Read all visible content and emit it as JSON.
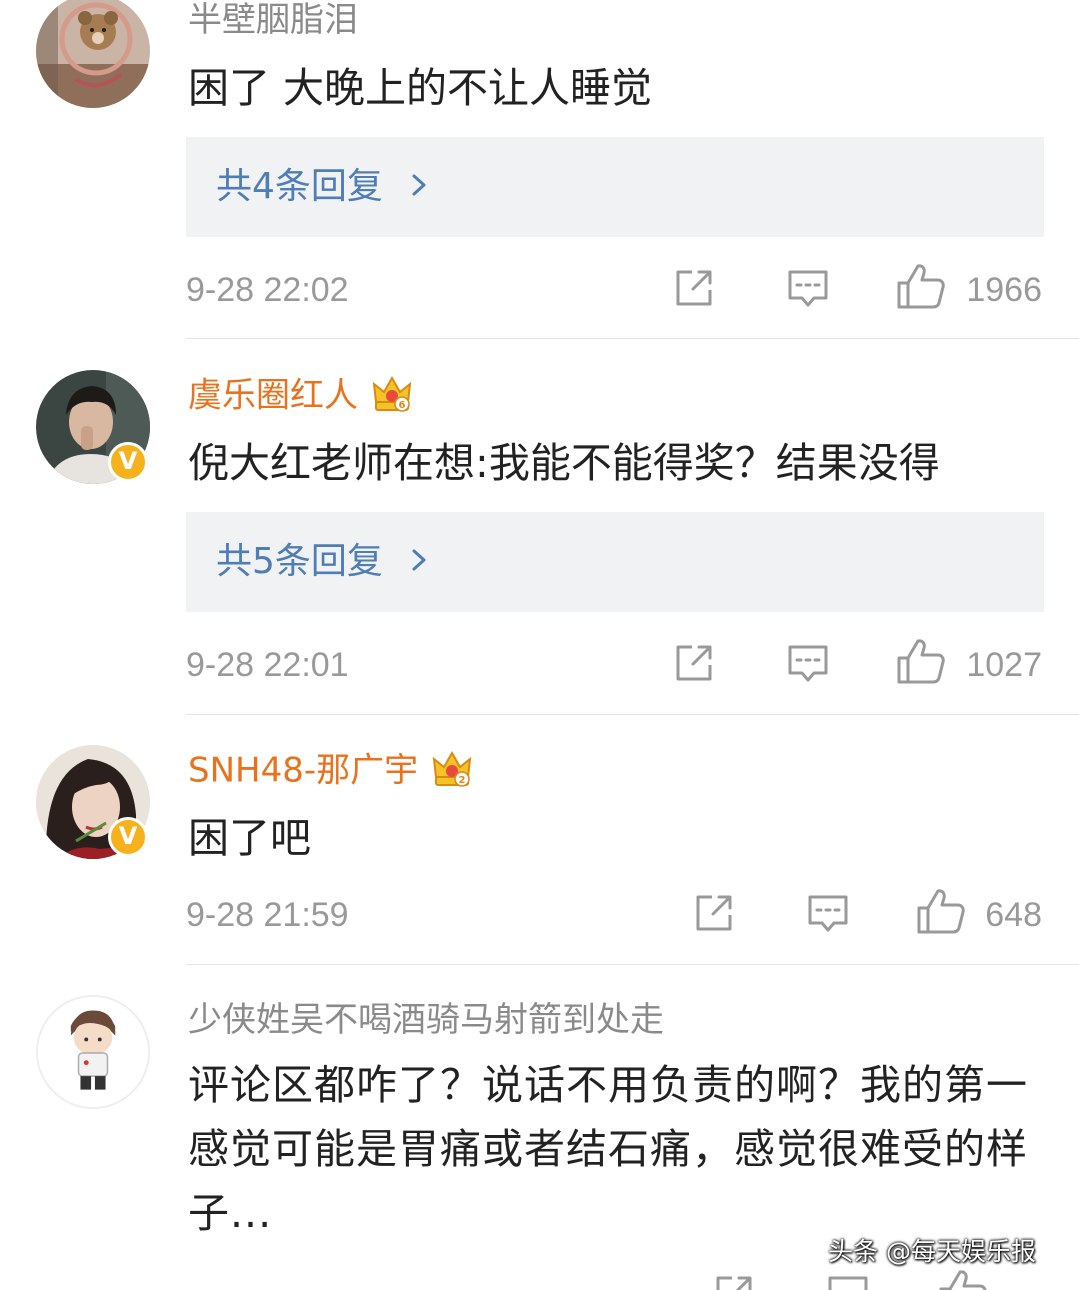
{
  "comments": [
    {
      "username": "半壁胭脂泪",
      "text": "困了 大晚上的不让人睡觉",
      "replies_label": "共4条回复",
      "time": "9-28 22:02",
      "likes": "1966",
      "verified": false,
      "vip": false
    },
    {
      "username": "虞乐圈红人",
      "text": "倪大红老师在想:我能不能得奖？结果没得",
      "replies_label": "共5条回复",
      "time": "9-28 22:01",
      "likes": "1027",
      "verified": true,
      "vip": true
    },
    {
      "username": "SNH48-那广宇",
      "text": "困了吧",
      "time": "9-28 21:59",
      "likes": "648",
      "verified": true,
      "vip": true
    },
    {
      "username": "少侠姓吴不喝酒骑马射箭到处走",
      "text": "评论区都咋了？说话不用负责的啊？我的第一感觉可能是胃痛或者结石痛，感觉很难受的样子...",
      "verified": false,
      "vip": false
    }
  ],
  "icons": {
    "share": "share-icon",
    "comment": "comment-icon",
    "like": "thumbs-up-icon",
    "chevron": "chevron-right-icon",
    "crown": "crown-badge-icon",
    "verified": "verified-badge-icon"
  },
  "colors": {
    "username_default": "#8a8a8a",
    "username_vip": "#e8731f",
    "reply_link": "#4f7db5",
    "reply_bg": "#f1f2f4",
    "meta": "#999999",
    "verified_badge": "#f6b21d"
  },
  "watermark": "头条 @每天娱乐报"
}
